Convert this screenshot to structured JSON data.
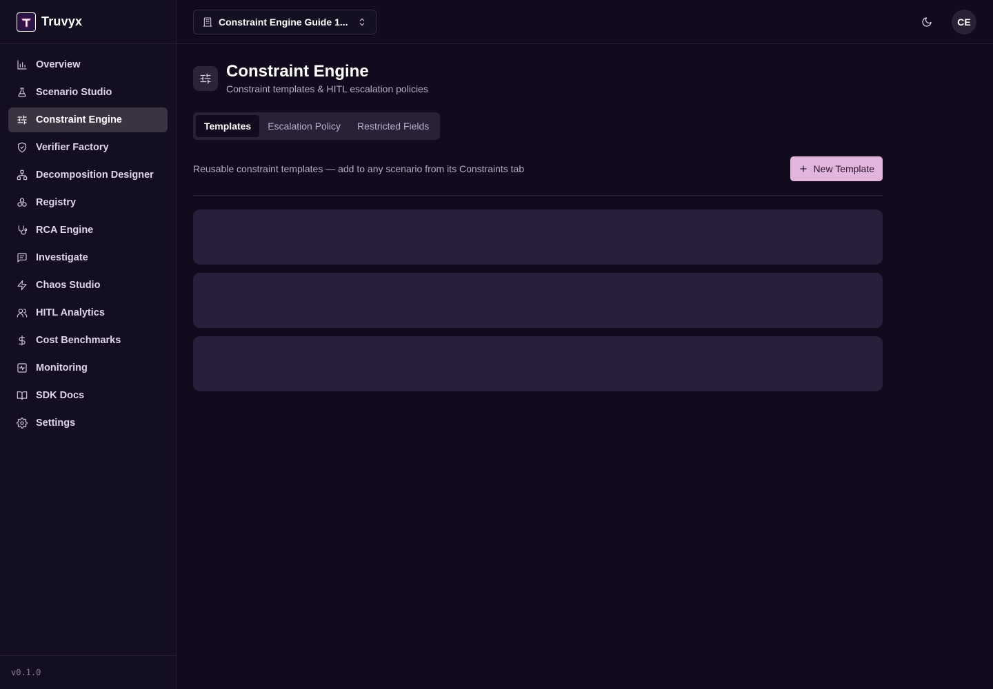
{
  "brand": {
    "name": "Truvyx",
    "logo_letter": "T"
  },
  "sidebar": {
    "items": [
      {
        "label": "Overview",
        "icon": "bar-chart-icon",
        "active": false
      },
      {
        "label": "Scenario Studio",
        "icon": "flask-icon",
        "active": false
      },
      {
        "label": "Constraint Engine",
        "icon": "sliders-icon",
        "active": true
      },
      {
        "label": "Verifier Factory",
        "icon": "shield-check-icon",
        "active": false
      },
      {
        "label": "Decomposition Designer",
        "icon": "network-icon",
        "active": false
      },
      {
        "label": "Registry",
        "icon": "boxes-icon",
        "active": false
      },
      {
        "label": "RCA Engine",
        "icon": "stethoscope-icon",
        "active": false
      },
      {
        "label": "Investigate",
        "icon": "message-square-icon",
        "active": false
      },
      {
        "label": "Chaos Studio",
        "icon": "zap-icon",
        "active": false
      },
      {
        "label": "HITL Analytics",
        "icon": "users-icon",
        "active": false
      },
      {
        "label": "Cost Benchmarks",
        "icon": "dollar-icon",
        "active": false
      },
      {
        "label": "Monitoring",
        "icon": "activity-square-icon",
        "active": false
      },
      {
        "label": "SDK Docs",
        "icon": "book-open-icon",
        "active": false
      },
      {
        "label": "Settings",
        "icon": "gear-icon",
        "active": false
      }
    ],
    "version": "v0.1.0"
  },
  "topbar": {
    "workspace": "Constraint Engine Guide 1...",
    "avatar_initials": "CE"
  },
  "page": {
    "title": "Constraint Engine",
    "subtitle": "Constraint templates & HITL escalation policies"
  },
  "tabs": [
    {
      "label": "Templates",
      "active": true
    },
    {
      "label": "Escalation Policy",
      "active": false
    },
    {
      "label": "Restricted Fields",
      "active": false
    }
  ],
  "templates": {
    "description": "Reusable constraint templates — add to any scenario from its Constraints tab",
    "new_button": "New Template"
  },
  "colors": {
    "background": "#110b1d",
    "sidebar": "#140e21",
    "active_item": "#3a3342",
    "accent_button": "#e2b6dc",
    "skeleton": "#2a1f3a"
  }
}
